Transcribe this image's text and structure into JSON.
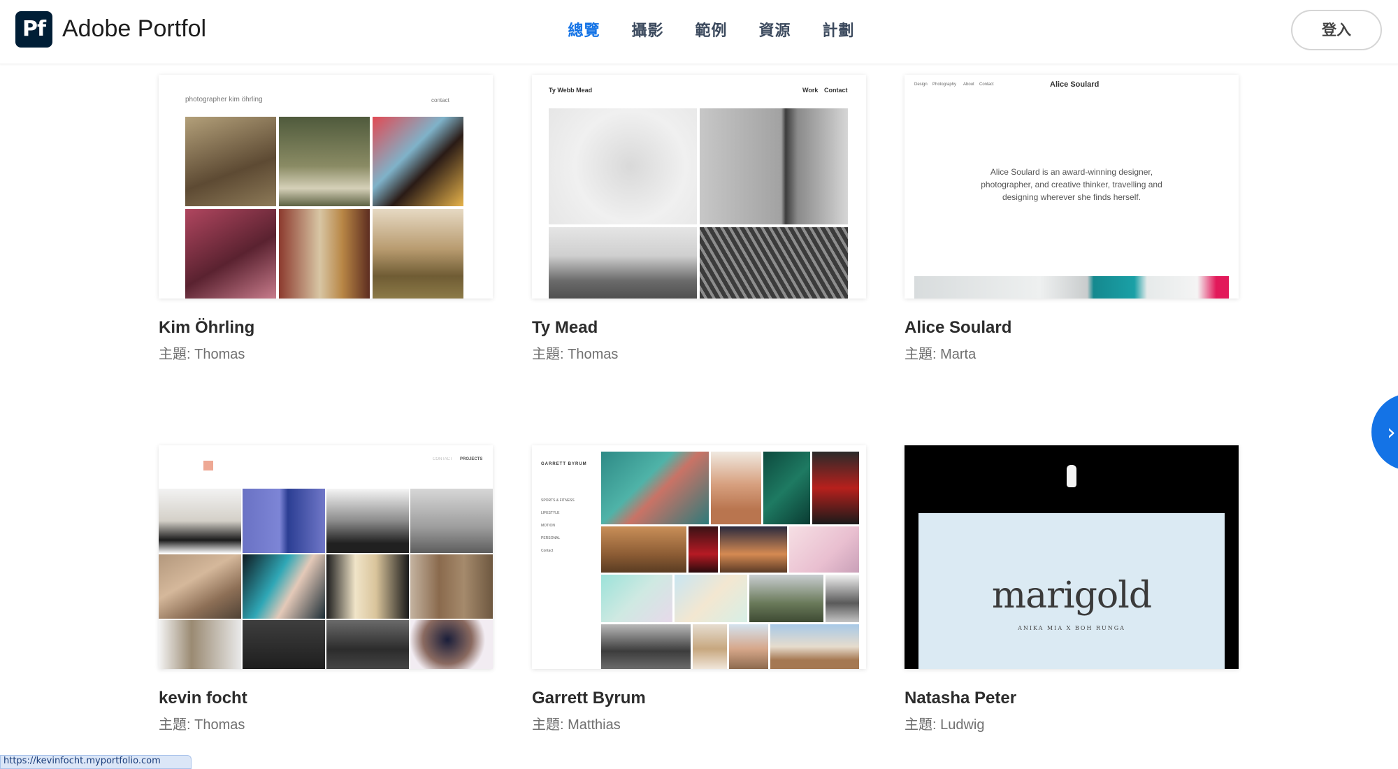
{
  "header": {
    "logo": "Pf",
    "brand": "Adobe Portfol",
    "nav": [
      {
        "label": "總覽",
        "active": true
      },
      {
        "label": "攝影",
        "active": false
      },
      {
        "label": "範例",
        "active": false
      },
      {
        "label": "資源",
        "active": false
      },
      {
        "label": "計劃",
        "active": false
      }
    ],
    "login_label": "登入"
  },
  "cards": [
    {
      "name": "Kim Öhrling",
      "theme": "主題: Thomas",
      "thumb": {
        "site_title": "photographer kim öhrling",
        "menu": [
          "contact"
        ]
      }
    },
    {
      "name": "Ty Mead",
      "theme": "主題: Thomas",
      "thumb": {
        "site_title": "Ty Webb Mead",
        "menu": [
          "Work",
          "Contact"
        ]
      }
    },
    {
      "name": "Alice Soulard",
      "theme": "主題: Marta",
      "thumb": {
        "site_title": "Alice Soulard",
        "menu": [
          "Design",
          "Photography",
          "About",
          "Contact"
        ],
        "bio": "Alice Soulard is an award-winning designer, photographer, and creative thinker, travelling and designing wherever she finds herself."
      }
    },
    {
      "name": "kevin focht",
      "theme": "主題: Thomas",
      "thumb": {
        "menu": [
          "CONTACT",
          "PROJECTS"
        ]
      }
    },
    {
      "name": "Garrett Byrum",
      "theme": "主題: Matthias",
      "thumb": {
        "site_title": "GARRETT BYRUM",
        "menu": [
          "SPORTS & FITNESS",
          "LIFESTYLE",
          "MOTION",
          "PERSONAL",
          "Contact"
        ]
      }
    },
    {
      "name": "Natasha Peter",
      "theme": "主題: Ludwig",
      "thumb": {
        "wordmark": "marigold",
        "credit": "ANIKA MIA X BOH RUNGA"
      }
    }
  ],
  "status_url": "https://kevinfocht.myportfolio.com",
  "colors": {
    "accent": "#1473e6",
    "logo_bg": "#001e36"
  }
}
